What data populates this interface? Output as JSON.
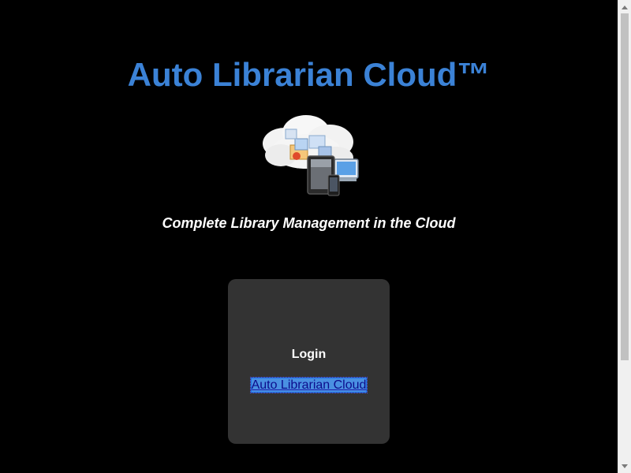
{
  "page": {
    "title": "Auto Librarian Cloud™",
    "tagline": "Complete Library Management in the Cloud",
    "hero_image": "cloud-devices-illustration"
  },
  "login": {
    "heading": "Login",
    "link_text": "Auto Librarian Cloud"
  },
  "colors": {
    "background": "#000000",
    "title": "#3b82d6",
    "panel": "#333333",
    "text": "#ffffff",
    "link": "#0d0d8c"
  },
  "icons": {
    "scroll_up": "chevron-up-icon",
    "scroll_down": "chevron-down-icon"
  }
}
